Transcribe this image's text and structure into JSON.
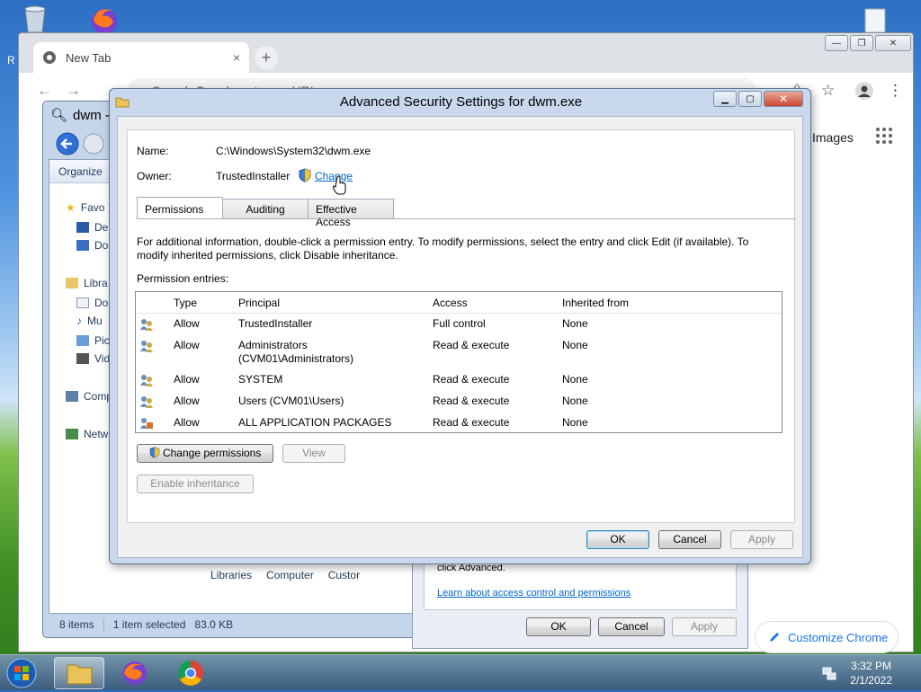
{
  "desktop": {
    "partial_label": "R"
  },
  "chrome": {
    "tab_title": "New Tab",
    "tab_close": "×",
    "new_tab": "+",
    "omnibox_placeholder": "Search Google or type a URL",
    "images_link": "Images",
    "customize_label": "Customize Chrome",
    "minimize": "—",
    "restore": "❐",
    "close": "✕"
  },
  "explorer": {
    "title": "dwm -",
    "organize": "Organize",
    "tree": [
      {
        "label": "Favo"
      },
      {
        "label": "De"
      },
      {
        "label": "Do"
      },
      {
        "label": "Libra"
      },
      {
        "label": "Do"
      },
      {
        "label": "Mu"
      },
      {
        "label": "Pic"
      },
      {
        "label": "Vid"
      },
      {
        "label": "Comp"
      },
      {
        "label": "Netw"
      }
    ],
    "bottom_links": [
      "Libraries",
      "Computer",
      "Custor"
    ],
    "status_items": "8 items",
    "status_selected": "1 item selected",
    "status_size": "83.0 KB"
  },
  "properties": {
    "text": "click Advanced.",
    "link": "Learn about access control and permissions",
    "ok": "OK",
    "cancel": "Cancel",
    "apply": "Apply"
  },
  "dialog": {
    "title": "Advanced Security Settings for dwm.exe",
    "name_label": "Name:",
    "name_value": "C:\\Windows\\System32\\dwm.exe",
    "owner_label": "Owner:",
    "owner_value": "TrustedInstaller",
    "owner_change": "Change",
    "tabs": [
      "Permissions",
      "Auditing",
      "Effective Access"
    ],
    "info_line1": "For additional information, double-click a permission entry. To modify permissions, select the entry and click Edit (if available). To",
    "info_line2": "modify inherited permissions, click Disable inheritance.",
    "entries_label": "Permission entries:",
    "columns": [
      "Type",
      "Principal",
      "Access",
      "Inherited from"
    ],
    "rows": [
      {
        "type": "Allow",
        "principal": "TrustedInstaller",
        "principal2": "",
        "access": "Full control",
        "inherited": "None",
        "icon": "users-icon"
      },
      {
        "type": "Allow",
        "principal": "Administrators",
        "principal2": "(CVM01\\Administrators)",
        "access": "Read & execute",
        "inherited": "None",
        "icon": "users-icon"
      },
      {
        "type": "Allow",
        "principal": "SYSTEM",
        "principal2": "",
        "access": "Read & execute",
        "inherited": "None",
        "icon": "users-icon"
      },
      {
        "type": "Allow",
        "principal": "Users (CVM01\\Users)",
        "principal2": "",
        "access": "Read & execute",
        "inherited": "None",
        "icon": "users-icon"
      },
      {
        "type": "Allow",
        "principal": "ALL APPLICATION PACKAGES",
        "principal2": "",
        "access": "Read & execute",
        "inherited": "None",
        "icon": "app-packages-icon"
      }
    ],
    "change_permissions": "Change permissions",
    "view": "View",
    "enable_inheritance": "Enable inheritance",
    "ok": "OK",
    "cancel": "Cancel",
    "apply": "Apply"
  },
  "taskbar": {
    "time": "3:32 PM",
    "date": "2/1/2022"
  },
  "colors": {
    "link": "#0066cc",
    "chrome_accent": "#1a73e8"
  }
}
